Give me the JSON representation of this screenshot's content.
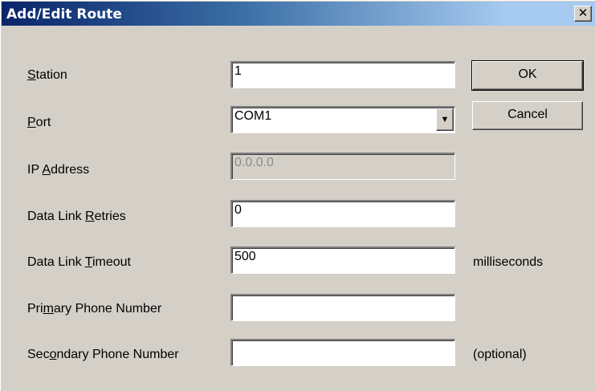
{
  "window": {
    "title": "Add/Edit Route",
    "close_glyph": "✕"
  },
  "form": {
    "station": {
      "label_pre": "",
      "label_key": "S",
      "label_post": "tation",
      "value": "1"
    },
    "port": {
      "label_pre": "",
      "label_key": "P",
      "label_post": "ort",
      "value": "COM1"
    },
    "ip_address": {
      "label_pre": "IP ",
      "label_key": "A",
      "label_post": "ddress",
      "value": "0.0.0.0"
    },
    "retries": {
      "label_pre": "Data Link ",
      "label_key": "R",
      "label_post": "etries",
      "value": "0"
    },
    "timeout": {
      "label_pre": "Data Link ",
      "label_key": "T",
      "label_post": "imeout",
      "value": "500",
      "suffix": "milliseconds"
    },
    "primary_phone": {
      "label_pre": "Pri",
      "label_key": "m",
      "label_post": "ary Phone Number",
      "value": ""
    },
    "secondary_phone": {
      "label_pre": "Sec",
      "label_key": "o",
      "label_post": "ndary Phone Number",
      "value": "",
      "suffix": "(optional)"
    }
  },
  "buttons": {
    "ok": "OK",
    "cancel": "Cancel"
  },
  "icons": {
    "dropdown": "chevron-down-icon",
    "close": "close-icon"
  }
}
